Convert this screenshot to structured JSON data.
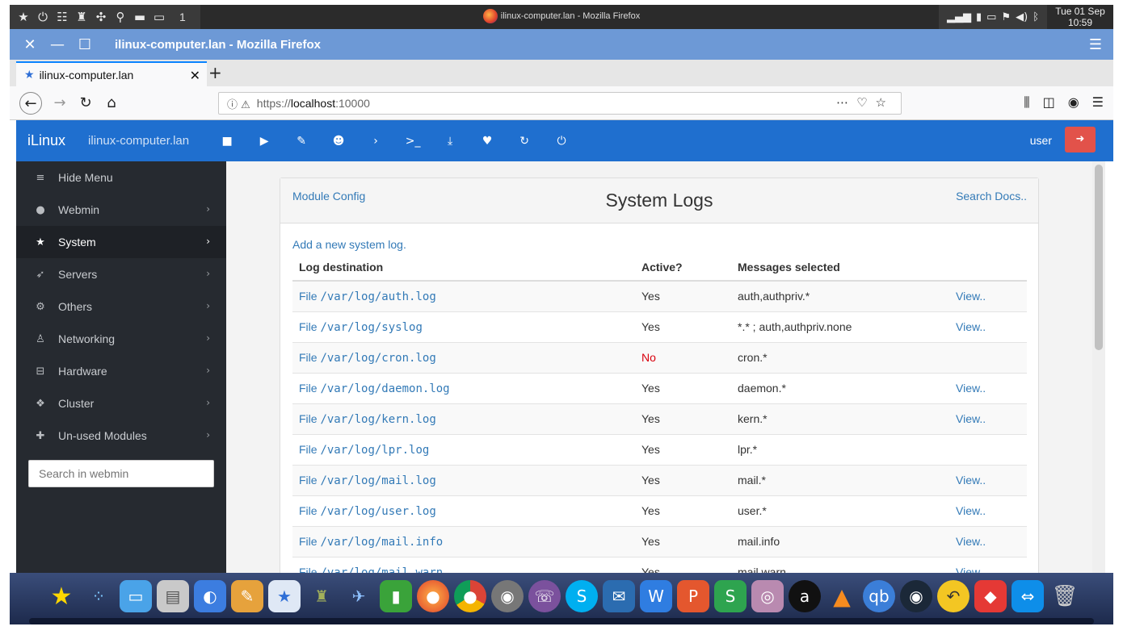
{
  "system_panel": {
    "workspace": "1",
    "window_title": "ilinux-computer.lan - Mozilla Firefox",
    "clock_day": "Tue 01 Sep",
    "clock_time": "10:59"
  },
  "firefox": {
    "title": "ilinux-computer.lan - Mozilla Firefox",
    "tab_title": "ilinux-computer.lan",
    "url_prefix": "https://",
    "url_host": "localhost",
    "url_suffix": ":10000"
  },
  "webmin": {
    "brand": "iLinux",
    "hostname": "ilinux-computer.lan",
    "user": "user"
  },
  "sidebar": {
    "items": [
      {
        "label": "Hide Menu",
        "icon": "hamburger-icon"
      },
      {
        "label": "Webmin",
        "icon": "globe-icon"
      },
      {
        "label": "System",
        "icon": "star-icon"
      },
      {
        "label": "Servers",
        "icon": "rocket-icon"
      },
      {
        "label": "Others",
        "icon": "gears-icon"
      },
      {
        "label": "Networking",
        "icon": "sitemap-icon"
      },
      {
        "label": "Hardware",
        "icon": "hdd-icon"
      },
      {
        "label": "Cluster",
        "icon": "cubes-icon"
      },
      {
        "label": "Un-used Modules",
        "icon": "puzzle-icon"
      }
    ],
    "search_placeholder": "Search in webmin"
  },
  "panel": {
    "module_config": "Module Config",
    "title": "System Logs",
    "search_docs": "Search Docs..",
    "add_link": "Add a new system log."
  },
  "table": {
    "headers": [
      "Log destination",
      "Active?",
      "Messages selected",
      ""
    ],
    "rows": [
      {
        "prefix": "File",
        "path": "/var/log/auth.log",
        "active": "Yes",
        "messages": "auth,authpriv.*",
        "view": "View.."
      },
      {
        "prefix": "File",
        "path": "/var/log/syslog",
        "active": "Yes",
        "messages": "*.* ; auth,authpriv.none",
        "view": "View.."
      },
      {
        "prefix": "File",
        "path": "/var/log/cron.log",
        "active": "No",
        "messages": "cron.*",
        "view": ""
      },
      {
        "prefix": "File",
        "path": "/var/log/daemon.log",
        "active": "Yes",
        "messages": "daemon.*",
        "view": "View.."
      },
      {
        "prefix": "File",
        "path": "/var/log/kern.log",
        "active": "Yes",
        "messages": "kern.*",
        "view": "View.."
      },
      {
        "prefix": "File",
        "path": "/var/log/lpr.log",
        "active": "Yes",
        "messages": "lpr.*",
        "view": ""
      },
      {
        "prefix": "File",
        "path": "/var/log/mail.log",
        "active": "Yes",
        "messages": "mail.*",
        "view": "View.."
      },
      {
        "prefix": "File",
        "path": "/var/log/user.log",
        "active": "Yes",
        "messages": "user.*",
        "view": "View.."
      },
      {
        "prefix": "File",
        "path": "/var/log/mail.info",
        "active": "Yes",
        "messages": "mail.info",
        "view": "View.."
      },
      {
        "prefix": "File",
        "path": "/var/log/mail.warn",
        "active": "Yes",
        "messages": "mail.warn",
        "view": "View.."
      }
    ]
  },
  "colors": {
    "webmin_blue": "#1f6fcf",
    "sidebar_dark": "#262a30",
    "link": "#337ab7",
    "inactive_red": "#d9000d",
    "logout_red": "#e2524a"
  }
}
